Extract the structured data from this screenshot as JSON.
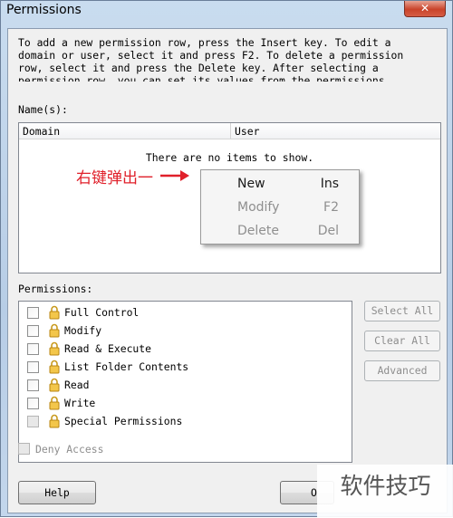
{
  "window": {
    "title": "Permissions",
    "close_glyph": "✕"
  },
  "instructions": "To add a new permission row, press the Insert key. To edit a\ndomain or user, select it and press F2. To delete a permission\nrow, select it and press the Delete key. After selecting a\npermission row, you can set its values from the permissions\nchecklist below.",
  "names": {
    "label": "Name(s):",
    "columns": [
      "Domain",
      "User"
    ],
    "empty_text": "There are no items to show."
  },
  "annotation": {
    "text": "右键弹出一",
    "color": "#e0202a"
  },
  "context_menu": {
    "items": [
      {
        "label": "New",
        "shortcut": "Ins",
        "enabled": true
      },
      {
        "label": "Modify",
        "shortcut": "F2",
        "enabled": false
      },
      {
        "label": "Delete",
        "shortcut": "Del",
        "enabled": false
      }
    ]
  },
  "permissions": {
    "label": "Permissions:",
    "items": [
      {
        "label": "Full Control",
        "checked": false
      },
      {
        "label": "Modify",
        "checked": false
      },
      {
        "label": "Read & Execute",
        "checked": false
      },
      {
        "label": "List Folder Contents",
        "checked": false
      },
      {
        "label": "Read",
        "checked": false
      },
      {
        "label": "Write",
        "checked": false
      },
      {
        "label": "Special Permissions",
        "checked": false
      }
    ],
    "buttons": {
      "select_all": "Select All",
      "clear_all": "Clear All",
      "advanced": "Advanced"
    }
  },
  "deny_access": {
    "label": "Deny Access",
    "checked": false
  },
  "footer": {
    "help": "Help",
    "ok_partial": "O"
  },
  "watermark": "软件技巧",
  "icons": {
    "lock": "lock-icon",
    "arrow": "arrow-right-icon"
  }
}
